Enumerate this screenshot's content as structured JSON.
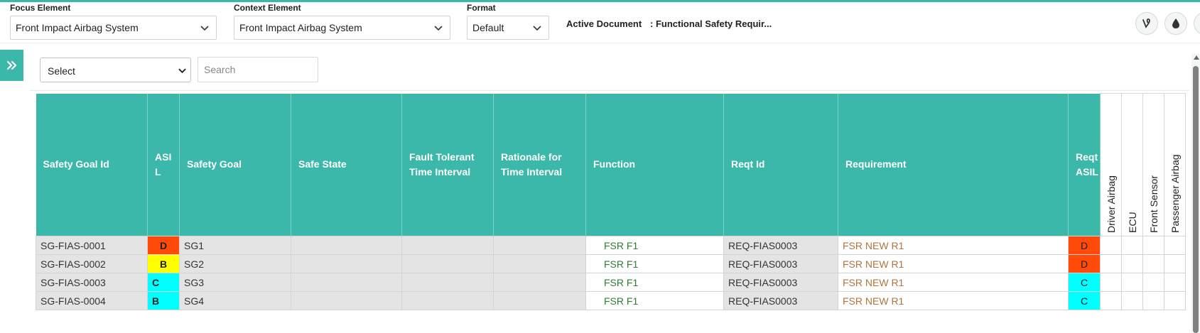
{
  "toolbar": {
    "focus_label": "Focus Element",
    "focus_value": "Front Impact Airbag System",
    "context_label": "Context Element",
    "context_value": "Front Impact Airbag System",
    "format_label": "Format",
    "format_value": "Default",
    "active_doc_label": "Active Document",
    "active_doc_value": ": Functional Safety Requir...",
    "buttons": [
      "vine-icon",
      "water-drop-icon",
      "more-icon"
    ]
  },
  "filter": {
    "select_value": "Select",
    "search_placeholder": "Search"
  },
  "table": {
    "headers": {
      "safety_goal_id": "Safety Goal Id",
      "asil": "ASIL",
      "safety_goal": "Safety Goal",
      "safe_state": "Safe State",
      "ftti": "Fault Tolerant Time Interval",
      "rationale": "Rationale for Time Interval",
      "function": "Function",
      "reqt_id": "Reqt Id",
      "requirement": "Requirement",
      "reqt_asil": "Reqt ASIL",
      "col_driver_airbag": "Driver Airbag",
      "col_ecu": "ECU",
      "col_front_sensor": "Front Sensor",
      "col_passenger_airbag": "Passenger Airbag"
    },
    "rows": [
      {
        "id": "SG-FIAS-0001",
        "asil": "D",
        "goal": "SG1",
        "safe_state": "",
        "ftti": "",
        "rationale": "",
        "function": "FSR F1",
        "reqt_id": "REQ-FIAS0003",
        "requirement": "FSR NEW R1",
        "reqt_asil": "D"
      },
      {
        "id": "SG-FIAS-0002",
        "asil": "B",
        "goal": "SG2",
        "safe_state": "",
        "ftti": "",
        "rationale": "",
        "function": "FSR F1",
        "reqt_id": "REQ-FIAS0003",
        "requirement": "FSR NEW R1",
        "reqt_asil": "D"
      },
      {
        "id": "SG-FIAS-0003",
        "asil": "C",
        "goal": "SG3",
        "safe_state": "",
        "ftti": "",
        "rationale": "",
        "function": "FSR F1",
        "reqt_id": "REQ-FIAS0003",
        "requirement": "FSR NEW R1",
        "reqt_asil": "C"
      },
      {
        "id": "SG-FIAS-0004",
        "asil": "B",
        "goal": "SG4",
        "safe_state": "",
        "ftti": "",
        "rationale": "",
        "function": "FSR F1",
        "reqt_id": "REQ-FIAS0003",
        "requirement": "FSR NEW R1",
        "reqt_asil": "C"
      }
    ]
  },
  "colors": {
    "accent": "#3bb8a9",
    "asil_d": "#ff4a0a",
    "asil_b": "#ffff00",
    "asil_c": "#00ffff",
    "function_text": "#2e7d32",
    "requirement_text": "#b5723a"
  }
}
